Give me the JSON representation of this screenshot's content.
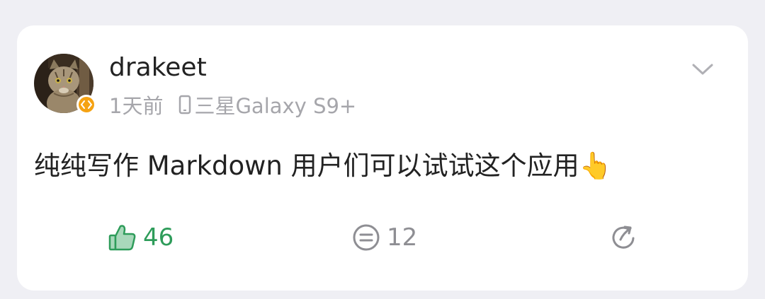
{
  "post": {
    "username": "drakeet",
    "time": "1天前",
    "device": "三星Galaxy S9+",
    "text": "纯纯写作 Markdown 用户们可以试试这个应用",
    "emoji": "👆",
    "likes": "46",
    "comments": "12"
  },
  "colors": {
    "like_accent": "#2e9c5a",
    "badge": "#f5a212",
    "meta_gray": "#a6a6ab",
    "icon_gray": "#8e8e93",
    "background": "#efeff4"
  },
  "icons": {
    "avatar_badge": "code-brackets-icon",
    "device": "phone-icon",
    "menu": "chevron-down-icon",
    "like": "thumbs-up-icon",
    "comment": "comment-bubble-icon",
    "share": "share-arrow-icon",
    "emoji": "pointing-up-hand-icon"
  }
}
